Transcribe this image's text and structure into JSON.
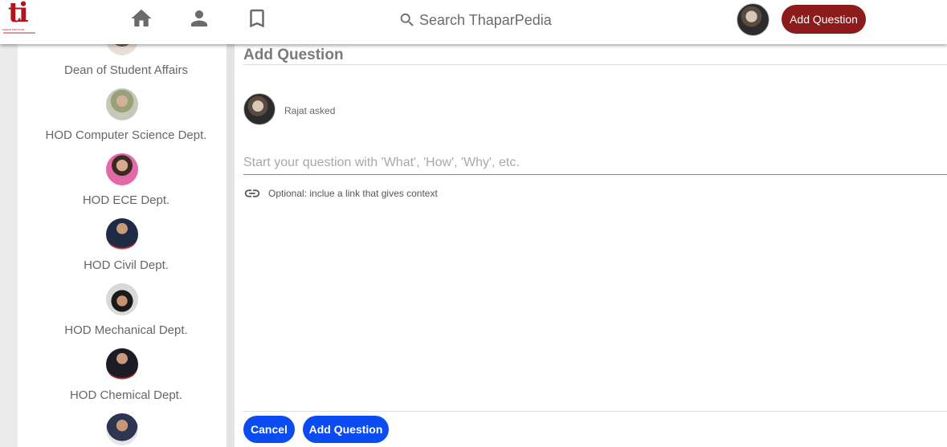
{
  "header": {
    "logo": {
      "mark": "ti",
      "text": "THAPAR INSTITUTE",
      "icon": "institute-logo"
    },
    "nav": [
      {
        "name": "home",
        "icon": "home-icon"
      },
      {
        "name": "profile",
        "icon": "person-icon"
      },
      {
        "name": "bookmarks",
        "icon": "bookmark-icon"
      }
    ],
    "search": {
      "placeholder": "Search ThaparPedia",
      "icon": "search-icon"
    },
    "add_question_label": "Add Question",
    "brand_color": "#8c1c1c"
  },
  "sidebar": {
    "items": [
      {
        "role": "Dean of Student Affairs"
      },
      {
        "role": "HOD Computer Science Dept."
      },
      {
        "role": "HOD ECE Dept."
      },
      {
        "role": "HOD Civil Dept."
      },
      {
        "role": "HOD Mechanical Dept."
      },
      {
        "role": "HOD Chemical Dept."
      },
      {
        "role": ""
      }
    ]
  },
  "modal": {
    "title": "Add Question",
    "asker": "Rajat asked",
    "question_placeholder": "Start your question with 'What', 'How', 'Why', etc.",
    "question_value": "",
    "link_hint": "Optional: inclue a link that gives context",
    "cancel_label": "Cancel",
    "submit_label": "Add Question",
    "button_color": "#0a4bf2"
  }
}
